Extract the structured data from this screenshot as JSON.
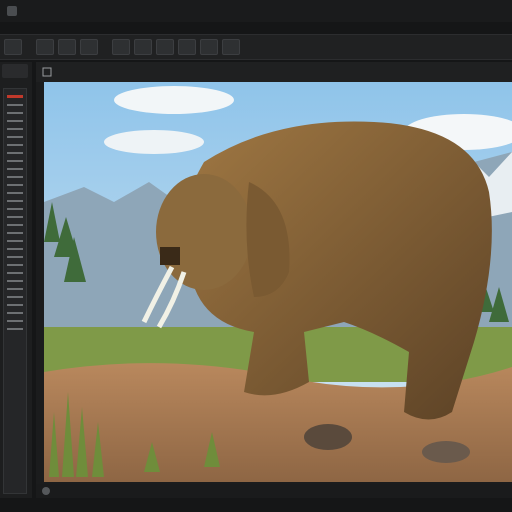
{
  "menubar": {
    "items": [
      "",
      "",
      "",
      "",
      "",
      ""
    ]
  },
  "toolbar": {
    "buttons": [
      "",
      "",
      "",
      "",
      "",
      "",
      "",
      "",
      "",
      ""
    ]
  },
  "viewport": {
    "title": "",
    "status": ""
  },
  "colors": {
    "sky": "#a8d2ef",
    "elephant": "#7a5a32",
    "ground": "#a77a52",
    "grass": "#6f8d3b"
  }
}
